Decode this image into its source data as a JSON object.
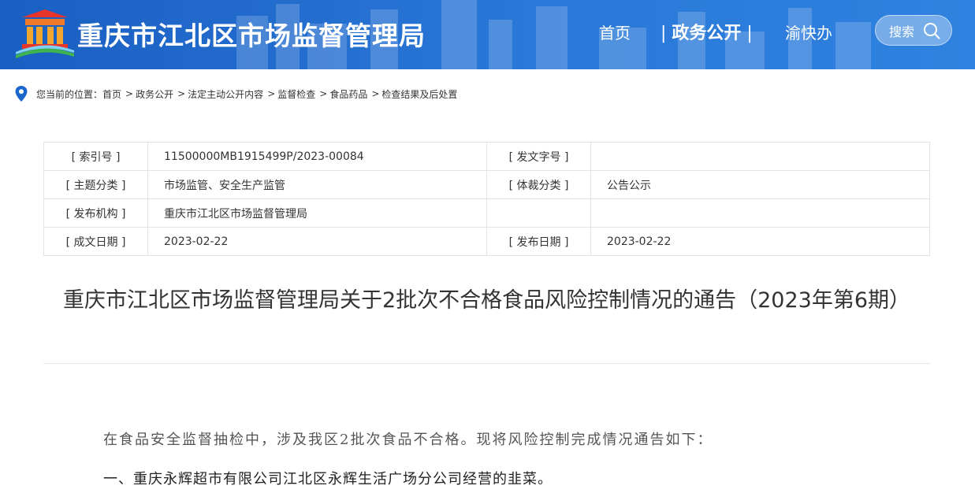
{
  "header": {
    "site_title": "重庆市江北区市场监督管理局",
    "nav": {
      "home": "首页",
      "active": "政务公开",
      "yukuaiban": "渝快办"
    },
    "search_label": "搜索"
  },
  "breadcrumb": {
    "prefix": "您当前的位置：",
    "items": [
      "首页",
      "政务公开",
      "法定主动公开内容",
      "监督检查",
      "食品药品",
      "检查结果及后处置"
    ]
  },
  "info": {
    "rows": [
      {
        "label1": "[ 索引号 ]",
        "value1": "11500000MB1915499P/2023-00084",
        "label2": "[ 发文字号 ]",
        "value2": ""
      },
      {
        "label1": "[ 主题分类 ]",
        "value1": "市场监管、安全生产监管",
        "label2": "[ 体裁分类 ]",
        "value2": "公告公示"
      },
      {
        "label1": "[ 发布机构 ]",
        "value1": "重庆市江北区市场监督管理局",
        "label2": "",
        "value2": ""
      },
      {
        "label1": "[ 成文日期 ]",
        "value1": "2023-02-22",
        "label2": "[ 发布日期 ]",
        "value2": "2023-02-22"
      }
    ]
  },
  "document": {
    "title": "重庆市江北区市场监督管理局关于2批次不合格食品风险控制情况的通告（2023年第6期）",
    "para1": "在食品安全监督抽检中，涉及我区2批次食品不合格。现将风险控制完成情况通告如下：",
    "para2": "一、重庆永辉超市有限公司江北区永辉生活广场分公司经营的韭菜。"
  },
  "colors": {
    "header_blue": "#2a78d8",
    "text": "#333333"
  }
}
